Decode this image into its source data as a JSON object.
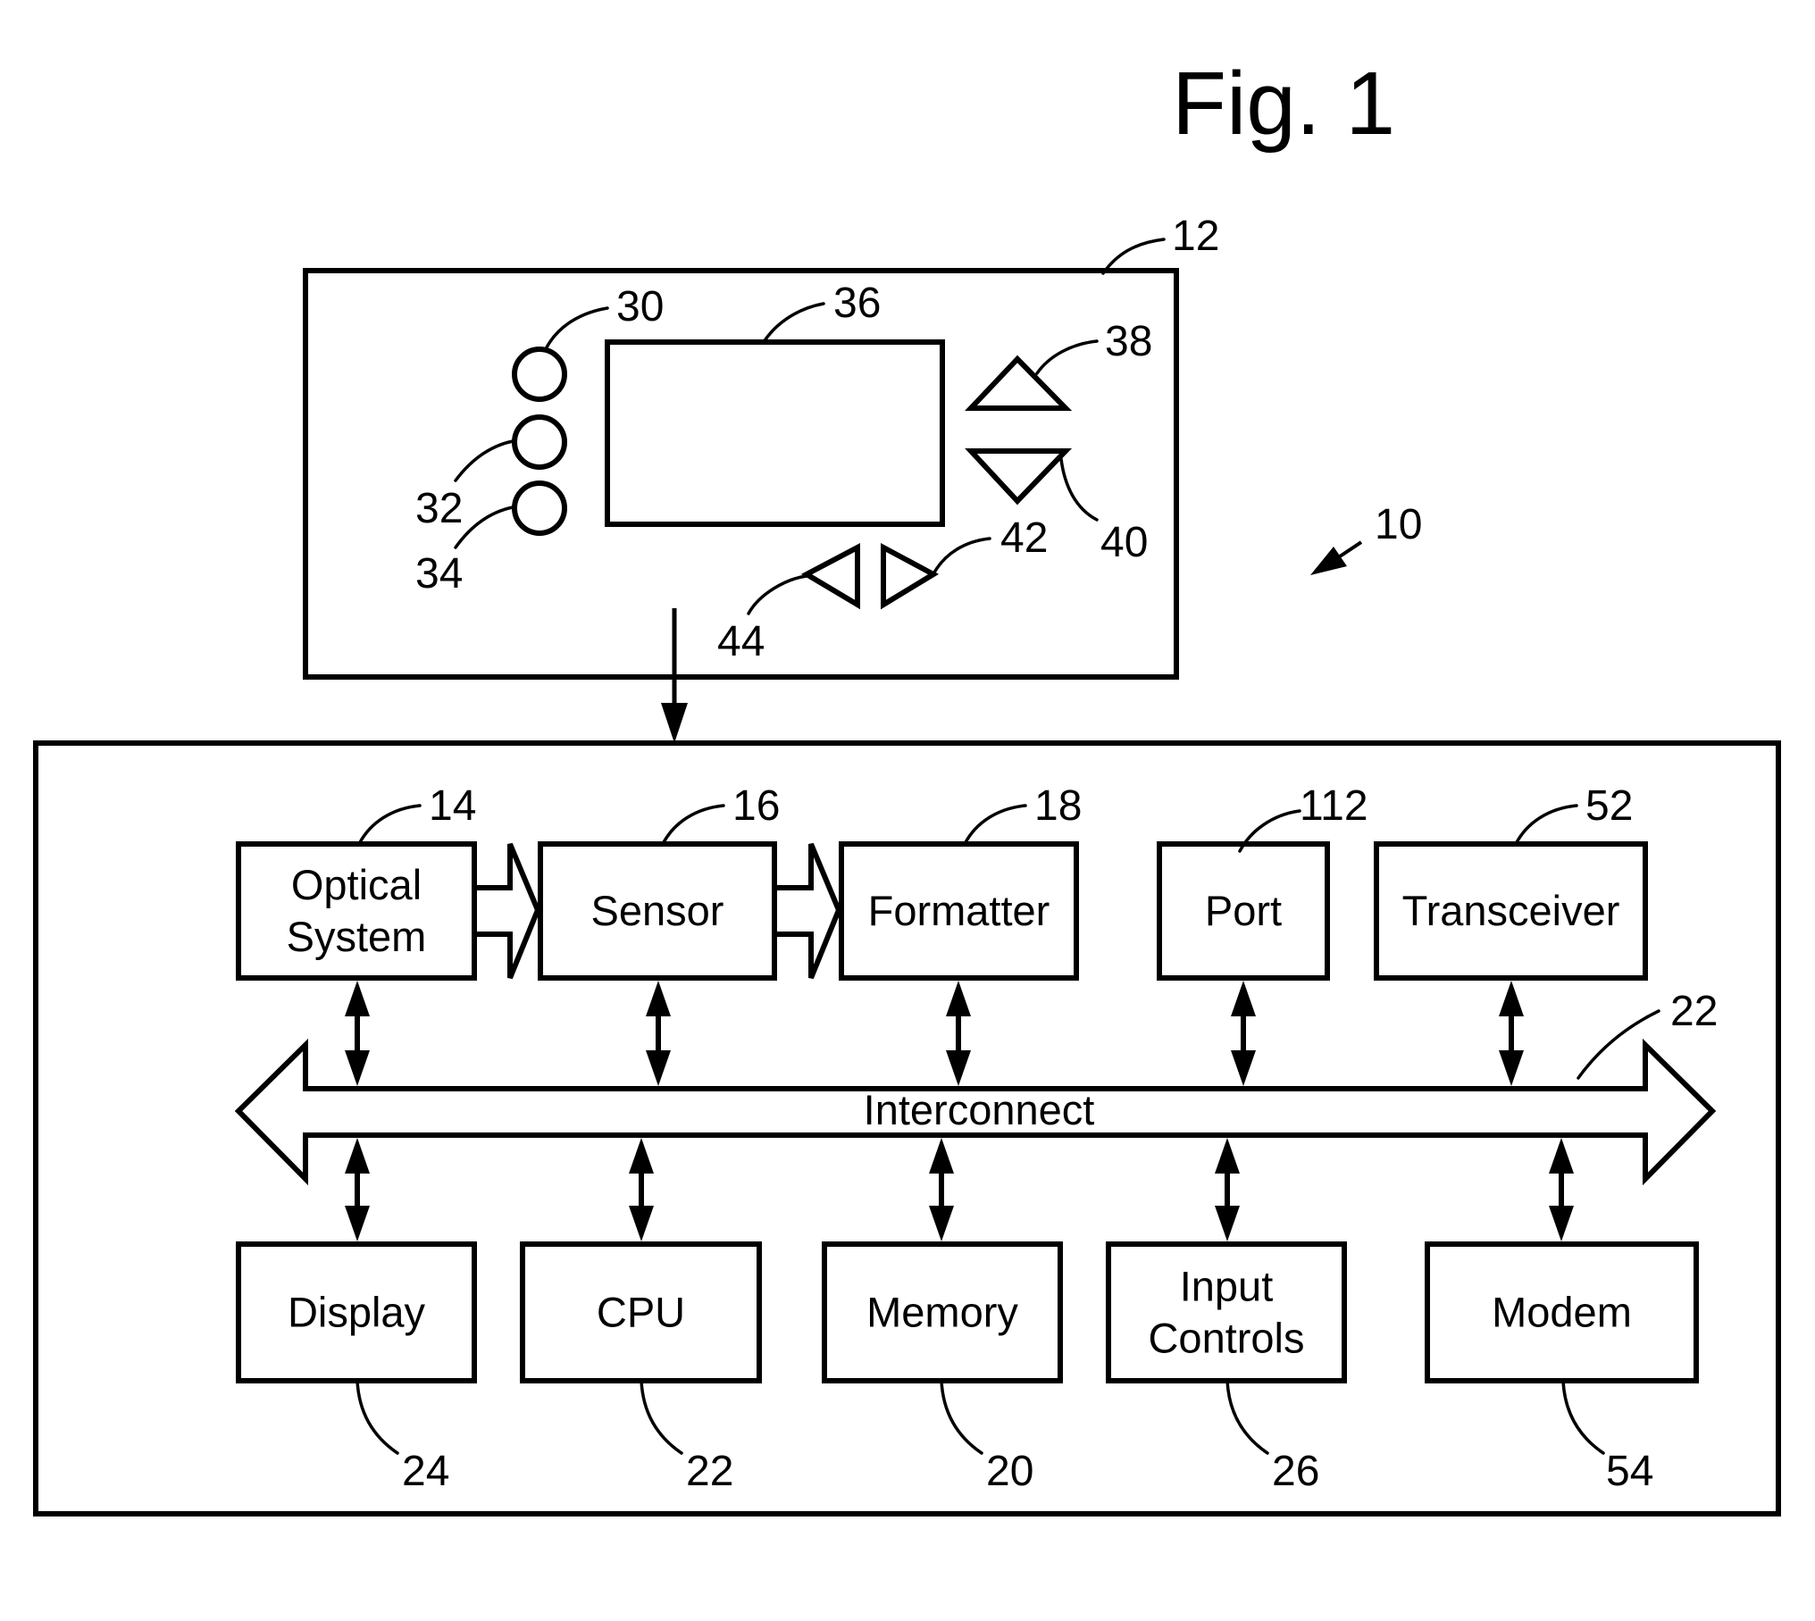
{
  "figure": {
    "title": "Fig. 1",
    "system_ref": "10"
  },
  "device": {
    "ref": "12",
    "buttons": [
      {
        "name": "button-1",
        "ref": "30"
      },
      {
        "name": "button-2",
        "ref": "32"
      },
      {
        "name": "button-3",
        "ref": "34"
      }
    ],
    "screen": {
      "ref": "36"
    },
    "up_key": {
      "ref": "38"
    },
    "down_key": {
      "ref": "40"
    },
    "right_key": {
      "ref": "42"
    },
    "left_key": {
      "ref": "44"
    }
  },
  "system": {
    "top_blocks": [
      {
        "id": "optical-system",
        "lines": [
          "Optical",
          "System"
        ],
        "ref": "14"
      },
      {
        "id": "sensor",
        "lines": [
          "Sensor"
        ],
        "ref": "16"
      },
      {
        "id": "formatter",
        "lines": [
          "Formatter"
        ],
        "ref": "18"
      },
      {
        "id": "port",
        "lines": [
          "Port"
        ],
        "ref": "112"
      },
      {
        "id": "transceiver",
        "lines": [
          "Transceiver"
        ],
        "ref": "52"
      }
    ],
    "bus": {
      "label": "Interconnect",
      "ref": "22"
    },
    "bottom_blocks": [
      {
        "id": "display",
        "lines": [
          "Display"
        ],
        "ref": "24"
      },
      {
        "id": "cpu",
        "lines": [
          "CPU"
        ],
        "ref": "22"
      },
      {
        "id": "memory",
        "lines": [
          "Memory"
        ],
        "ref": "20"
      },
      {
        "id": "input-controls",
        "lines": [
          "Input",
          "Controls"
        ],
        "ref": "26"
      },
      {
        "id": "modem",
        "lines": [
          "Modem"
        ],
        "ref": "54"
      }
    ]
  }
}
